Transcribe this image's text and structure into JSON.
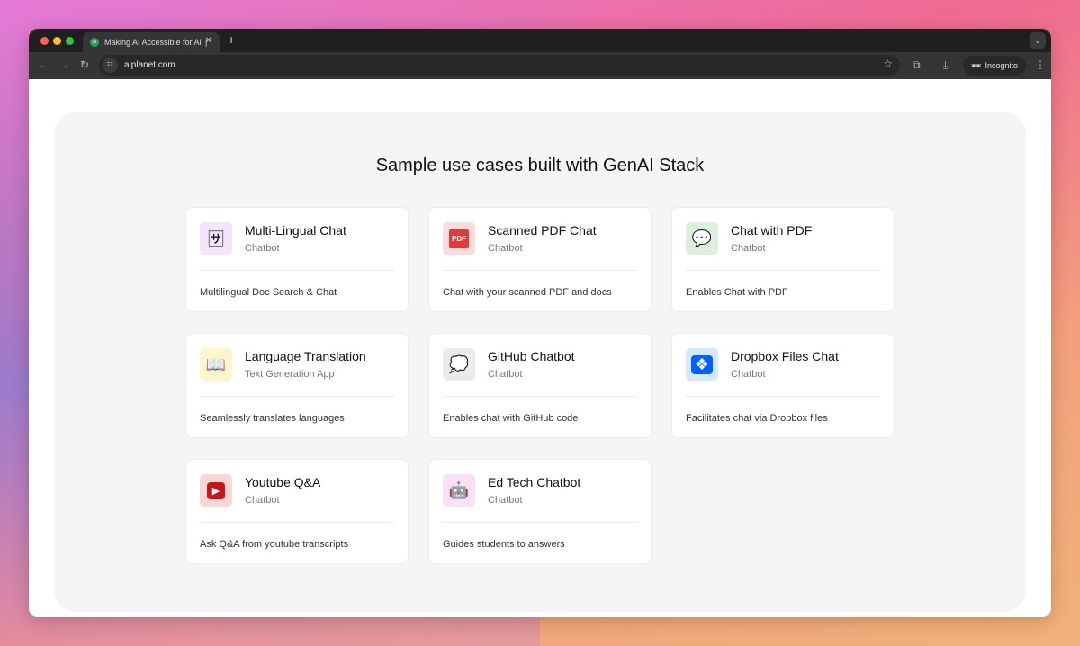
{
  "browser": {
    "tab_title": "Making AI Accessible for All |",
    "url": "aiplanet.com",
    "incognito_label": "Incognito",
    "favicon_text": "ai"
  },
  "page": {
    "title": "Sample use cases built with GenAI Stack"
  },
  "cards": [
    {
      "title": "Multi-Lingual Chat",
      "subtitle": "Chatbot",
      "description": "Multilingual Doc Search & Chat",
      "icon": "translate-icon",
      "icon_bg": "#f3e3fb",
      "glyph": "🈂"
    },
    {
      "title": "Scanned PDF Chat",
      "subtitle": "Chatbot",
      "description": "Chat with your scanned PDF and docs",
      "icon": "pdf-icon",
      "icon_bg": "#fbdcdc",
      "glyph": "PDF"
    },
    {
      "title": "Chat with PDF",
      "subtitle": "Chatbot",
      "description": "Enables Chat with PDF",
      "icon": "chat-bubbles-icon",
      "icon_bg": "#dcefdc",
      "glyph": "💬"
    },
    {
      "title": "Language Translation",
      "subtitle": "Text Generation App",
      "description": "Seamlessly translates languages",
      "icon": "book-icon",
      "icon_bg": "#fdf5cc",
      "glyph": "📖"
    },
    {
      "title": "GitHub Chatbot",
      "subtitle": "Chatbot",
      "description": "Enables chat with GitHub code",
      "icon": "speech-bubble-icon",
      "icon_bg": "#ebebed",
      "glyph": "💭"
    },
    {
      "title": "Dropbox Files Chat",
      "subtitle": "Chatbot",
      "description": "Facilitates chat via Dropbox files",
      "icon": "dropbox-icon",
      "icon_bg": "#d6e8fb",
      "glyph": "❖"
    },
    {
      "title": "Youtube Q&A",
      "subtitle": "Chatbot",
      "description": "Ask Q&A from youtube transcripts",
      "icon": "youtube-icon",
      "icon_bg": "#fbd6d6",
      "glyph": "▶"
    },
    {
      "title": "Ed Tech Chatbot",
      "subtitle": "Chatbot",
      "description": "Guides students to answers",
      "icon": "robot-icon",
      "icon_bg": "#f9e0f4",
      "glyph": "🤖"
    }
  ]
}
